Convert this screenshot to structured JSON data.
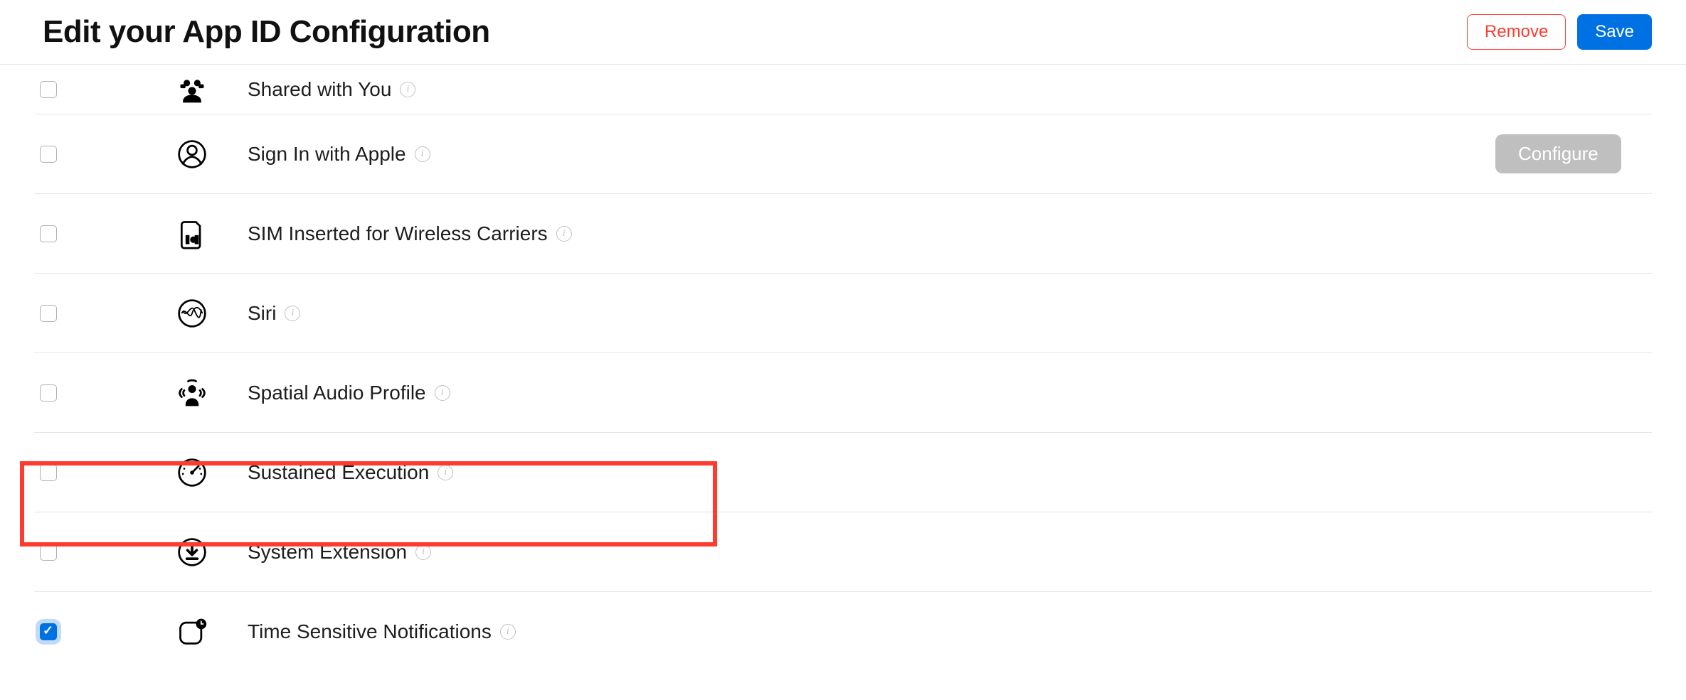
{
  "header": {
    "title": "Edit your App ID Configuration",
    "remove_label": "Remove",
    "save_label": "Save"
  },
  "capabilities": [
    {
      "key": "shared_with_you",
      "label": "Shared with You",
      "checked": false,
      "configure": false,
      "icon": "people-icon"
    },
    {
      "key": "sign_in_apple",
      "label": "Sign In with Apple",
      "checked": false,
      "configure": true,
      "icon": "person-circle-icon"
    },
    {
      "key": "sim_carriers",
      "label": "SIM Inserted for Wireless Carriers",
      "checked": false,
      "configure": false,
      "icon": "sim-icon"
    },
    {
      "key": "siri",
      "label": "Siri",
      "checked": false,
      "configure": false,
      "icon": "siri-icon"
    },
    {
      "key": "spatial_audio",
      "label": "Spatial Audio Profile",
      "checked": false,
      "configure": false,
      "icon": "spatial-audio-icon"
    },
    {
      "key": "sustained_exec",
      "label": "Sustained Execution",
      "checked": false,
      "configure": false,
      "icon": "gauge-icon"
    },
    {
      "key": "system_extension",
      "label": "System Extension",
      "checked": false,
      "configure": false,
      "icon": "download-circle-icon"
    },
    {
      "key": "time_sensitive",
      "label": "Time Sensitive Notifications",
      "checked": true,
      "configure": false,
      "icon": "time-badge-icon",
      "highlight": true
    }
  ],
  "configure_label": "Configure"
}
